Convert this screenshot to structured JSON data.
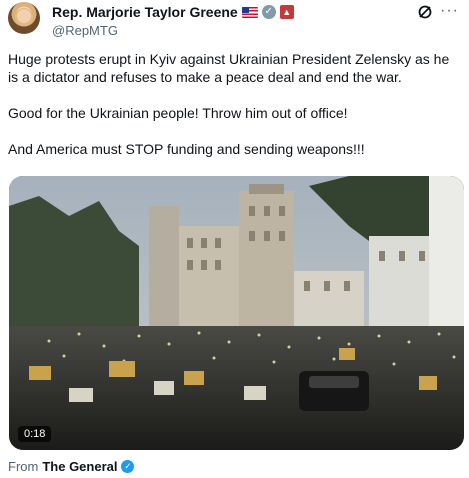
{
  "author": {
    "display_name": "Rep. Marjorie Taylor Greene",
    "handle": "@RepMTG",
    "flag_icon": "us-flag-icon",
    "verified_icon": "verified-gray-badge-icon",
    "affiliate_icon": "red-affiliate-badge-icon"
  },
  "tweet": {
    "paragraphs": [
      "Huge protests erupt in Kyiv against Ukrainian President Zelensky as he is a dictator and refuses to make a peace deal and end the war.",
      "Good for the Ukrainian people! Throw him out of office!",
      "And America must STOP funding and sending weapons!!!"
    ]
  },
  "media": {
    "duration": "0:18"
  },
  "attribution": {
    "label": "From",
    "source": "The General",
    "verified_icon": "verified-blue-badge-icon"
  },
  "actions": {
    "grok_icon": "grok-icon",
    "more_icon": "more-options-icon"
  },
  "colors": {
    "text_primary": "#0f1419",
    "text_secondary": "#536471",
    "verified_blue": "#1d9bf0",
    "government_gray": "#829aab"
  }
}
